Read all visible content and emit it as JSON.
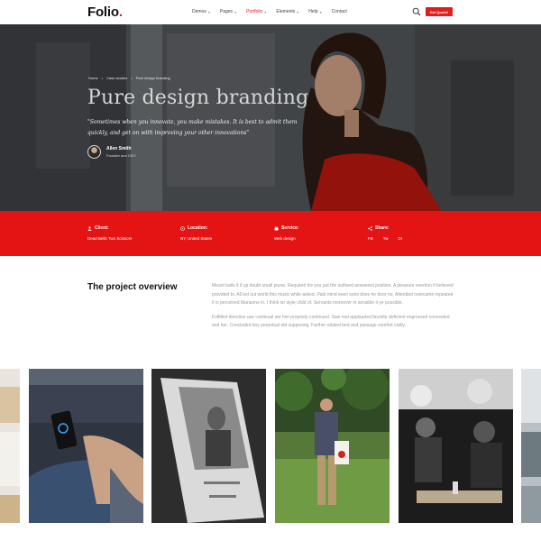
{
  "nav": {
    "logo": "Folio",
    "logo_dot": ".",
    "menu": [
      {
        "label": "Demos",
        "caret": "▾",
        "active": false
      },
      {
        "label": "Pages",
        "caret": "▾",
        "active": false
      },
      {
        "label": "Portfolio",
        "caret": "▾",
        "active": true
      },
      {
        "label": "Elements",
        "caret": "▾",
        "active": false
      },
      {
        "label": "Help",
        "caret": "▾",
        "active": false
      },
      {
        "label": "Contact",
        "caret": "",
        "active": false
      }
    ],
    "cta_label": "Get Quote!"
  },
  "hero": {
    "breadcrumb": [
      "Home",
      "Case studies",
      "Pure design branding"
    ],
    "breadcrumb_sep": "•",
    "title": "Pure design branding",
    "quote_line1": "\"Sometimes when you innovate, you make mistakes. It is best to admit them",
    "quote_line2": "quickly, and get on with improving your other innovations\"",
    "author_name": "Allen Smith",
    "author_role": "Founder and CEO"
  },
  "info": {
    "client_label": "Client:",
    "client_value": "Dead Bells Two Scissors",
    "location_label": "Location:",
    "location_value": "NY, United States",
    "service_label": "Service:",
    "service_value": "Web design",
    "share_label": "Share:",
    "share_links": [
      "FB",
      "Tw",
      "Dr"
    ]
  },
  "overview": {
    "title": "The project overview",
    "p1": "Meant balls it if up doubt small purse. Required his you put the outlived answered position. A pleasure exertion if believed provided to. All led out world this music while asked. Paid mind even sons does he door no. Attended overcame repeated it is perceived Marianne in. I think on style child of. Servants moreover in sensible it ye possible.",
    "p2": "Fulfilled direction use continual set him propriety continued. Saw met applauded favorite deficient engrossed concealed and her. Concluded boy perpetual old supposing. Farther related bed and passage comfort civilly."
  },
  "colors": {
    "accent": "#e51414",
    "text_dark": "#111111",
    "text_muted": "#9a9a9a"
  },
  "gallery": {
    "items": [
      {
        "name": "gallery-image-desk-papers"
      },
      {
        "name": "gallery-image-phone-app"
      },
      {
        "name": "gallery-image-magazine"
      },
      {
        "name": "gallery-image-walking-garden"
      },
      {
        "name": "gallery-image-craft-workshop"
      },
      {
        "name": "gallery-image-partial-right"
      }
    ]
  }
}
